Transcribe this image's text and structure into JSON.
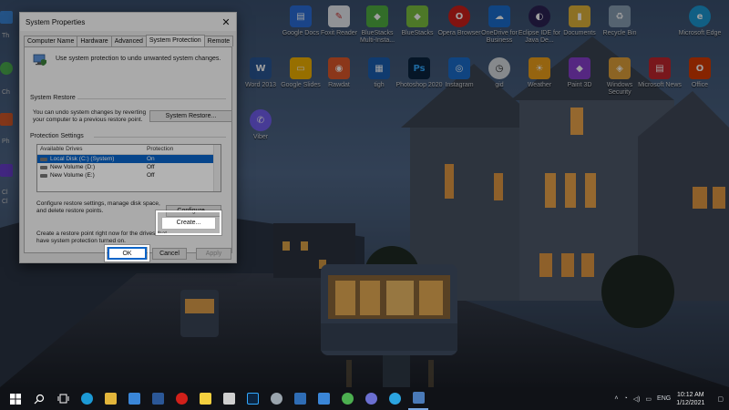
{
  "dialog": {
    "title": "System Properties",
    "tabs": [
      "Computer Name",
      "Hardware",
      "Advanced",
      "System Protection",
      "Remote"
    ],
    "intro": "Use system protection to undo unwanted system changes.",
    "restore_group": "System Restore",
    "restore_desc": "You can undo system changes by reverting\nyour computer to a previous restore point.",
    "restore_button": "System Restore...",
    "protection_group": "Protection Settings",
    "list_headers": [
      "Available Drives",
      "Protection"
    ],
    "drives": [
      {
        "name": "Local Disk (C:) (System)",
        "protection": "On",
        "selected": true
      },
      {
        "name": "New Volume (D:)",
        "protection": "Off",
        "selected": false
      },
      {
        "name": "New Volume (E:)",
        "protection": "Off",
        "selected": false
      }
    ],
    "configure_desc": "Configure restore settings, manage disk space,\nand delete restore points.",
    "configure_button": "Configure...",
    "create_desc": "Create a restore point right now for the drives that\nhave system protection turned on.",
    "create_button": "Create...",
    "ok_button": "OK",
    "cancel_button": "Cancel",
    "apply_button": "Apply"
  },
  "desktop_icons": [
    {
      "label": "Google Docs",
      "color": "#2a6fdb",
      "glyph": "▤",
      "icon": "google-docs-icon"
    },
    {
      "label": "Foxit Reader",
      "color": "#e8ecf2",
      "glyph": "✎",
      "icon": "foxit-reader-icon"
    },
    {
      "label": "BlueStacks Multi-Insta...",
      "color": "#52b043",
      "glyph": "◆",
      "icon": "bluestacks-multi-icon"
    },
    {
      "label": "BlueStacks",
      "color": "#7cc242",
      "glyph": "◆",
      "icon": "bluestacks-icon"
    },
    {
      "label": "Opera Browser",
      "color": "#d1201a",
      "glyph": "O",
      "icon": "opera-icon"
    },
    {
      "label": "OneDrive for Business",
      "color": "#1b6fd1",
      "glyph": "☁",
      "icon": "onedrive-icon"
    },
    {
      "label": "Eclipse IDE for Java De...",
      "color": "#2c2255",
      "glyph": "◐",
      "icon": "eclipse-icon"
    },
    {
      "label": "Documents",
      "color": "#e2b53b",
      "glyph": "▮",
      "icon": "documents-folder-icon"
    },
    {
      "label": "Recycle Bin",
      "color": "#8aa0b5",
      "glyph": "♻",
      "icon": "recycle-bin-icon"
    },
    {
      "label": "Microsoft Edge",
      "color": "#1c9ad6",
      "glyph": "e",
      "icon": "edge-icon"
    },
    {
      "label": "Word 2013",
      "color": "#2b5797",
      "glyph": "W",
      "icon": "word-icon"
    },
    {
      "label": "Google Slides",
      "color": "#f4b400",
      "glyph": "▭",
      "icon": "google-slides-icon"
    },
    {
      "label": "Rawdat",
      "color": "#e05a2b",
      "glyph": "◉",
      "icon": "rawdat-icon"
    },
    {
      "label": "tigh",
      "color": "#1a5fb4",
      "glyph": "▦",
      "icon": "calendar-icon"
    },
    {
      "label": "Photoshop 2020",
      "color": "#0b2440",
      "glyph": "Ps",
      "icon": "photoshop-icon"
    },
    {
      "label": "Instagram",
      "color": "#1a6fcf",
      "glyph": "◎",
      "icon": "instagram-icon"
    },
    {
      "label": "gid",
      "color": "#d8dde3",
      "glyph": "◷",
      "icon": "clock-icon"
    },
    {
      "label": "Weather",
      "color": "#f1a21a",
      "glyph": "☀",
      "icon": "weather-icon"
    },
    {
      "label": "Paint 3D",
      "color": "#8a3fd1",
      "glyph": "◆",
      "icon": "paint-3d-icon"
    },
    {
      "label": "Windows Security",
      "color": "#e2a23b",
      "glyph": "◈",
      "icon": "windows-security-icon"
    },
    {
      "label": "Microsoft News",
      "color": "#c4262e",
      "glyph": "▤",
      "icon": "microsoft-news-icon"
    },
    {
      "label": "Office",
      "color": "#d83b01",
      "glyph": "O",
      "icon": "office-icon"
    },
    {
      "label": "Viber",
      "color": "#7360f2",
      "glyph": "✆",
      "icon": "viber-icon"
    }
  ],
  "left_edge_labels": [
    "Th",
    "Ch",
    "Ph",
    "Cl",
    "Cl"
  ],
  "taskbar": {
    "icons": [
      {
        "name": "start-button",
        "color": "#ffffff"
      },
      {
        "name": "search-icon",
        "color": "#ffffff"
      },
      {
        "name": "task-view-icon",
        "color": "#ffffff"
      },
      {
        "name": "edge-icon",
        "color": "#1c9ad6"
      },
      {
        "name": "file-explorer-icon",
        "color": "#e2b53b"
      },
      {
        "name": "mail-icon",
        "color": "#3a86d8"
      },
      {
        "name": "word-icon",
        "color": "#2b5797"
      },
      {
        "name": "opera-icon",
        "color": "#d1201a"
      },
      {
        "name": "sticky-notes-icon",
        "color": "#f4d03f"
      },
      {
        "name": "store-icon",
        "color": "#cfcfcf"
      },
      {
        "name": "photoshop-icon",
        "color": "#31a8ff"
      },
      {
        "name": "settings-icon",
        "color": "#9aa4ad"
      },
      {
        "name": "virtualbox-icon",
        "color": "#2f6db5"
      },
      {
        "name": "photos-icon",
        "color": "#3a86d8"
      },
      {
        "name": "chrome-icon",
        "color": "#4caf50"
      },
      {
        "name": "app-icon",
        "color": "#6b6fd1"
      },
      {
        "name": "skype-icon",
        "color": "#2ba4e0"
      },
      {
        "name": "system-properties-icon",
        "color": "#4a7ab8"
      }
    ],
    "language": "ENG",
    "time": "10:12 AM",
    "date": "1/12/2021"
  }
}
